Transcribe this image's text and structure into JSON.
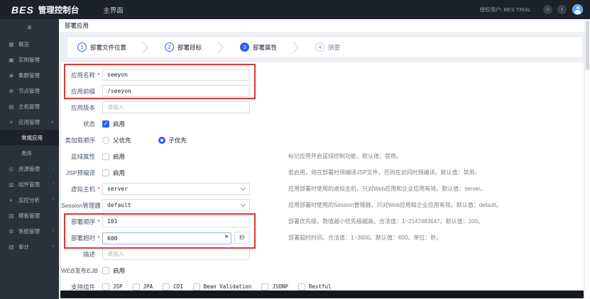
{
  "topbar": {
    "logo": "BES",
    "product": "管理控制台",
    "tab_main": "主界面",
    "licensed_user": "授权用户: BES TRIAL",
    "home_icon_glyph": "⌂",
    "info_icon_glyph": "i"
  },
  "sidebar": {
    "items": [
      {
        "label": "概览",
        "glyph": "▦"
      },
      {
        "label": "实例管理",
        "glyph": "▣"
      },
      {
        "label": "集群管理",
        "glyph": "◈"
      },
      {
        "label": "节点管理",
        "glyph": "⊕"
      },
      {
        "label": "主机管理",
        "glyph": "▤"
      },
      {
        "label": "应用管理",
        "glyph": "≡",
        "arrow": "∨"
      },
      {
        "label": "常规应用"
      },
      {
        "label": "类库"
      },
      {
        "label": "资源管理",
        "glyph": "◎",
        "arrow": "›"
      },
      {
        "label": "组件管理",
        "glyph": "▥",
        "arrow": "›"
      },
      {
        "label": "监控分析",
        "glyph": "◐",
        "arrow": "›"
      },
      {
        "label": "模板管理",
        "glyph": "▧"
      },
      {
        "label": "系统管理",
        "glyph": "⚙",
        "arrow": "›"
      },
      {
        "label": "审计",
        "glyph": "▨",
        "arrow": "›"
      }
    ]
  },
  "breadcrumb": "部署应用",
  "steps": [
    {
      "num": "1",
      "label": "部署文件位置",
      "state": "done"
    },
    {
      "num": "2",
      "label": "部署目标",
      "state": "done"
    },
    {
      "num": "3",
      "label": "部署属性",
      "state": "active"
    },
    {
      "num": "4",
      "label": "摘要",
      "state": "pending"
    }
  ],
  "form": {
    "required_mark": "*",
    "app_name": {
      "label": "应用名称",
      "value": "seeyon"
    },
    "app_prefix": {
      "label": "应用前缀",
      "value": "/seeyon"
    },
    "app_version": {
      "label": "应用版本",
      "placeholder": "请输入"
    },
    "status": {
      "label": "状态",
      "option": "启用",
      "checked": true,
      "check_glyph": "✓"
    },
    "class_load_order": {
      "label": "类加载顺序",
      "option_parent": "父优先",
      "option_child": "子优先",
      "selected": "子优先"
    },
    "blue_green": {
      "label": "蓝绿属性",
      "option": "启用",
      "checked": false,
      "hint": "标记应用开启蓝绿控制功能，默认值：禁用。"
    },
    "jsp_precompile": {
      "label": "JSP预编译",
      "option": "启用",
      "checked": false,
      "hint": "若启用，则在部署时预编译JSP文件，否则在访问时预编译。默认值：禁用。"
    },
    "virtual_host": {
      "label": "虚拟主机",
      "value": "server",
      "hint": "应用部署时使用的虚拟主机，只对Web应用和企业应用有效。默认值：server。"
    },
    "session_manager": {
      "label": "Session管理器",
      "value": "default",
      "hint": "应用部署时使用的Session管理器，只对Web应用和企业应用有效。默认值：default。"
    },
    "deploy_order": {
      "label": "部署顺序",
      "value": "101",
      "hint": "部署优先级，数值越小优先级越高。合法值：1~2147483647。默认值：100。"
    },
    "deploy_timeout": {
      "label": "部署超时",
      "value": "600",
      "suffix": "秒",
      "clear_glyph": "×",
      "hint": "部署超时时间。合法值：1~3600。默认值：600。单位：秒。"
    },
    "description": {
      "label": "描述",
      "placeholder": "请输入"
    },
    "web_ejb": {
      "label": "WEB发布EJB",
      "option": "启用",
      "checked": false
    },
    "support_components": {
      "label": "支持组件",
      "options": [
        "JSP",
        "JPA",
        "CDI",
        "Bean Validation",
        "JSONP",
        "Restful"
      ]
    }
  }
}
